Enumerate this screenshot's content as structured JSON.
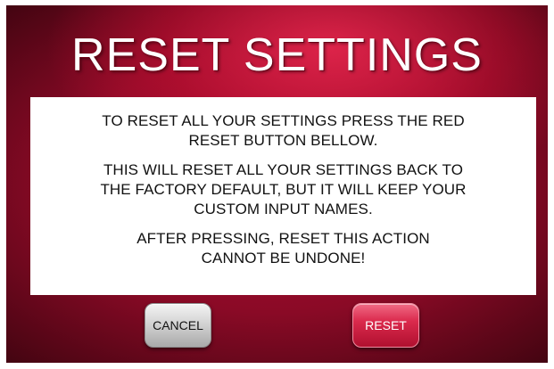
{
  "title": "RESET SETTINGS",
  "message": {
    "para1": [
      "TO RESET ALL YOUR SETTINGS PRESS THE RED",
      "RESET BUTTON BELLOW."
    ],
    "para2": [
      "THIS WILL RESET ALL YOUR SETTINGS BACK TO",
      "THE FACTORY DEFAULT, BUT IT WILL KEEP YOUR",
      "CUSTOM INPUT NAMES."
    ],
    "para3": [
      "AFTER PRESSING, RESET THIS ACTION",
      "CANNOT BE UNDONE!"
    ]
  },
  "buttons": {
    "cancel_label": "CANCEL",
    "reset_label": "RESET"
  },
  "colors": {
    "background_red": "#b00f34",
    "reset_button": "#db2a4d",
    "cancel_button": "#d4d4d4"
  }
}
